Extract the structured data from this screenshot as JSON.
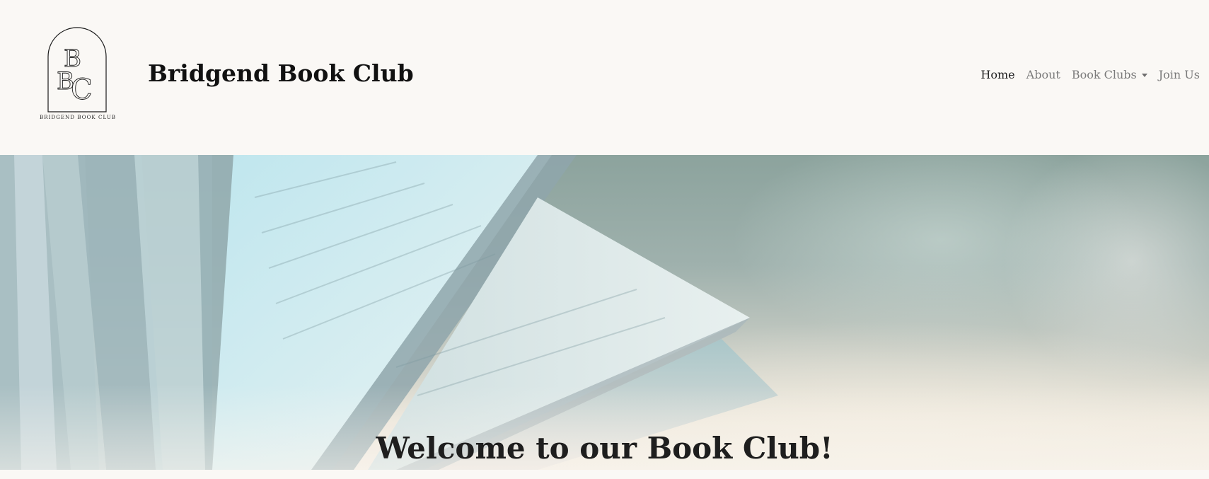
{
  "header": {
    "logo": {
      "monogram": "BBC",
      "caption": "BRIDGEND BOOK CLUB"
    },
    "site_title": "Bridgend Book Club"
  },
  "nav": {
    "items": [
      {
        "label": "Home",
        "active": true
      },
      {
        "label": "About",
        "active": false
      },
      {
        "label": "Book Clubs",
        "active": false,
        "has_dropdown": true
      },
      {
        "label": "Join Us",
        "active": false
      }
    ]
  },
  "hero": {
    "title": "Welcome to our Book Club!",
    "image": "open-book-pages"
  },
  "colors": {
    "background": "#faf8f5",
    "title_text": "#111111",
    "nav_active": "#1f1f1f",
    "nav_inactive": "#7a7a7a"
  }
}
